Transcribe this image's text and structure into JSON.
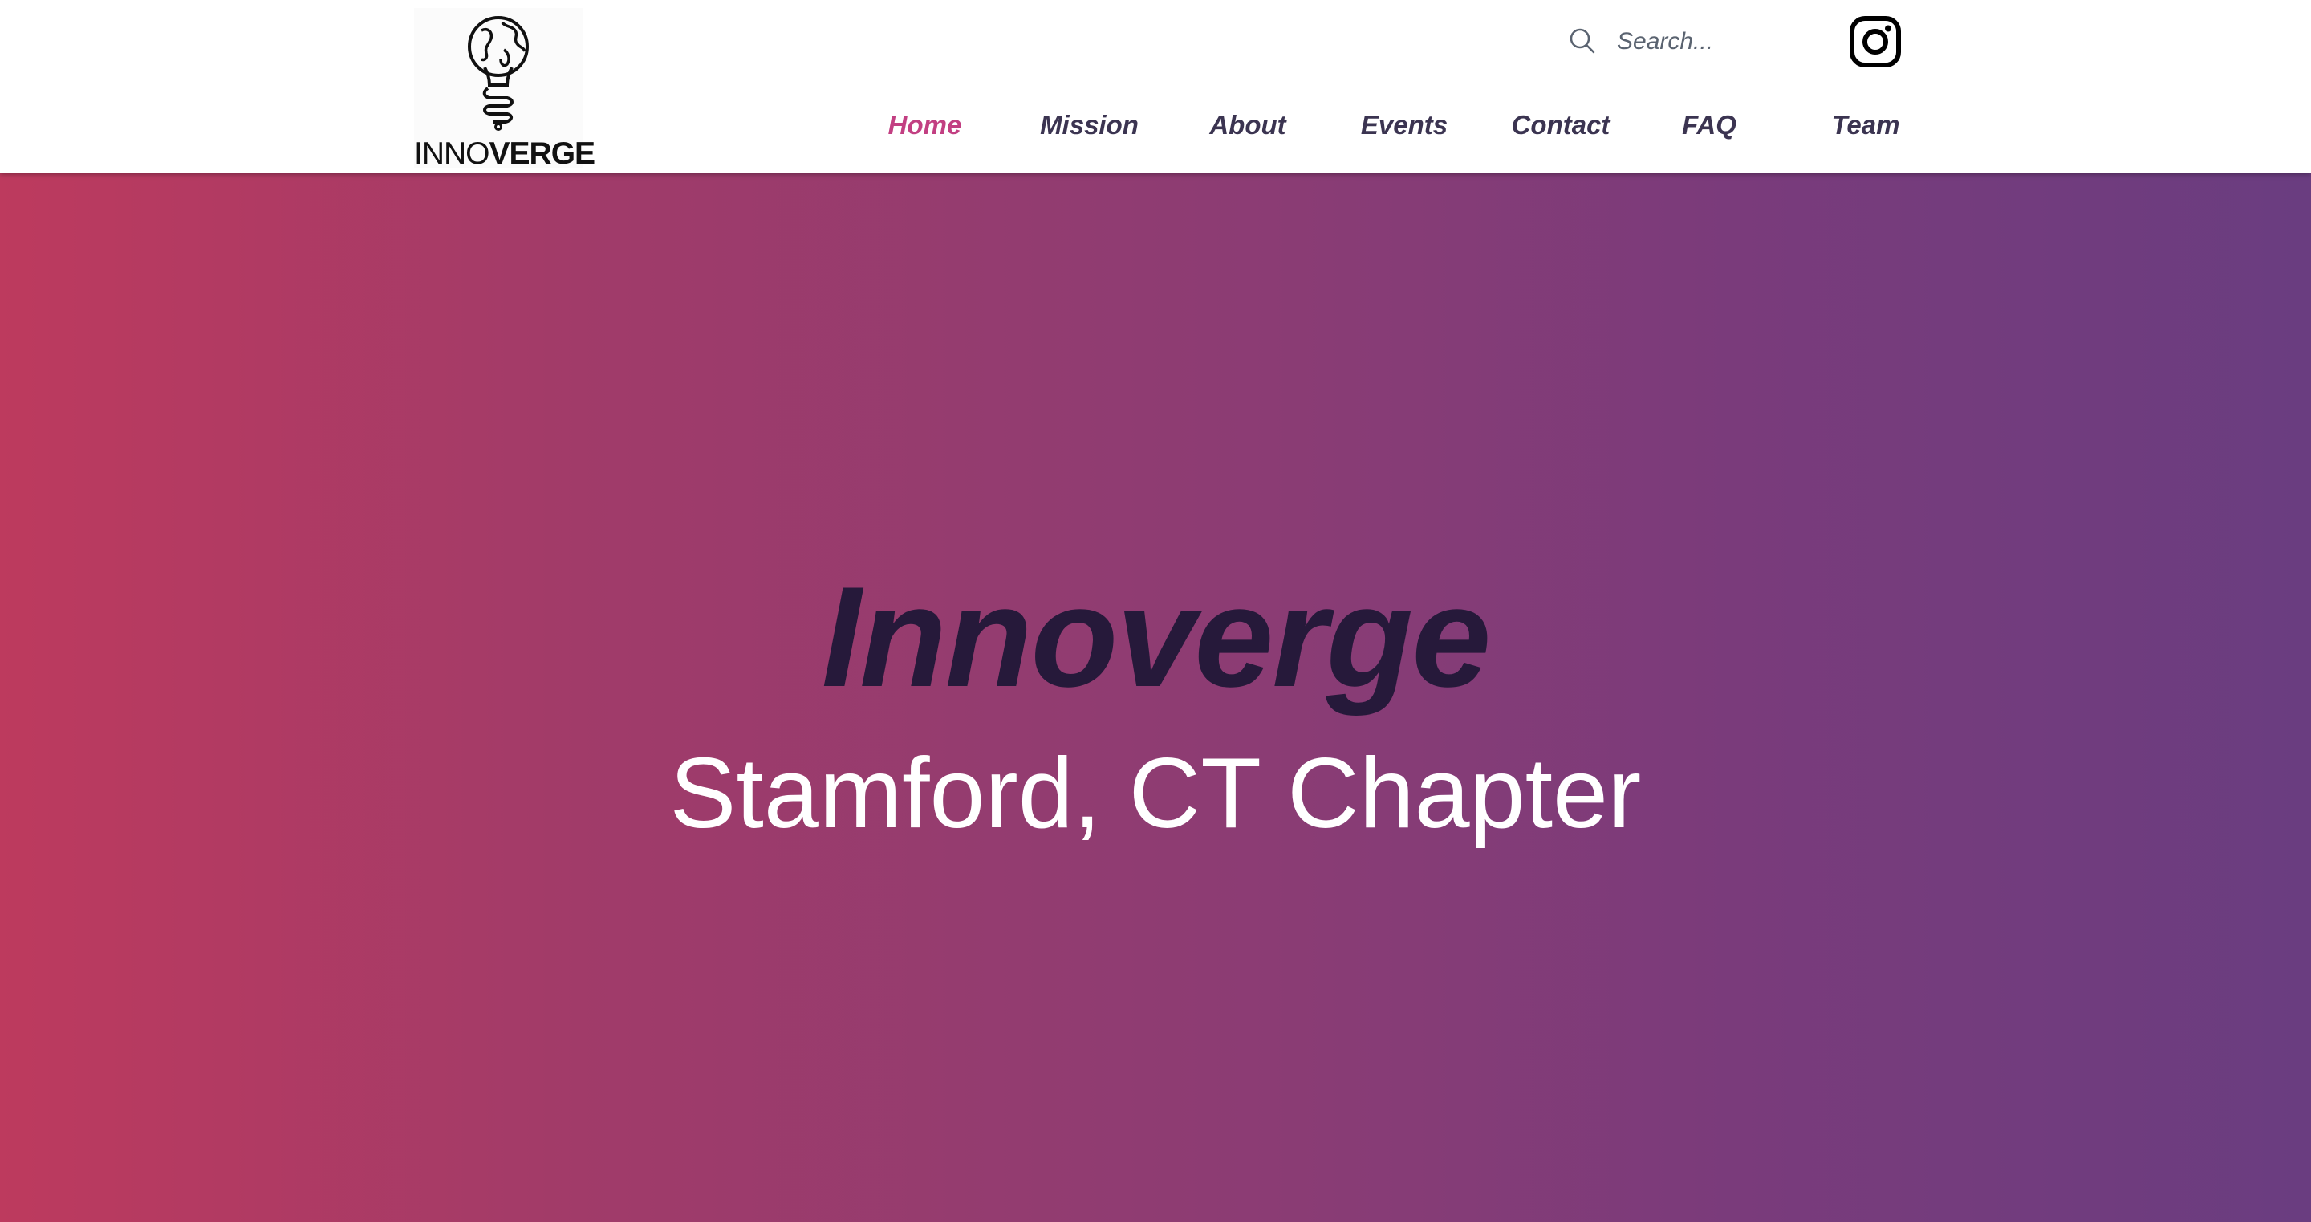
{
  "header": {
    "logo": {
      "word_light": "INNO",
      "word_bold": "VERGE",
      "icon": "globe-lightbulb-icon"
    },
    "search": {
      "placeholder": "Search...",
      "value": "",
      "icon": "search-icon"
    },
    "social": {
      "icon": "instagram-icon"
    },
    "nav": {
      "items": [
        {
          "label": "Home",
          "active": true
        },
        {
          "label": "Mission",
          "active": false
        },
        {
          "label": "About",
          "active": false
        },
        {
          "label": "Events",
          "active": false
        },
        {
          "label": "Contact",
          "active": false
        },
        {
          "label": "FAQ",
          "active": false
        },
        {
          "label": "Team",
          "active": false
        }
      ]
    }
  },
  "hero": {
    "title": "Innoverge",
    "subtitle": "Stamford, CT Chapter"
  },
  "colors": {
    "nav_active": "#c23f82",
    "nav_text": "#3b3451",
    "gradient_start": "#bd3a5e",
    "gradient_end": "#6a3d80",
    "hero_title": "#26193a",
    "hero_subtitle": "#ffffff"
  }
}
